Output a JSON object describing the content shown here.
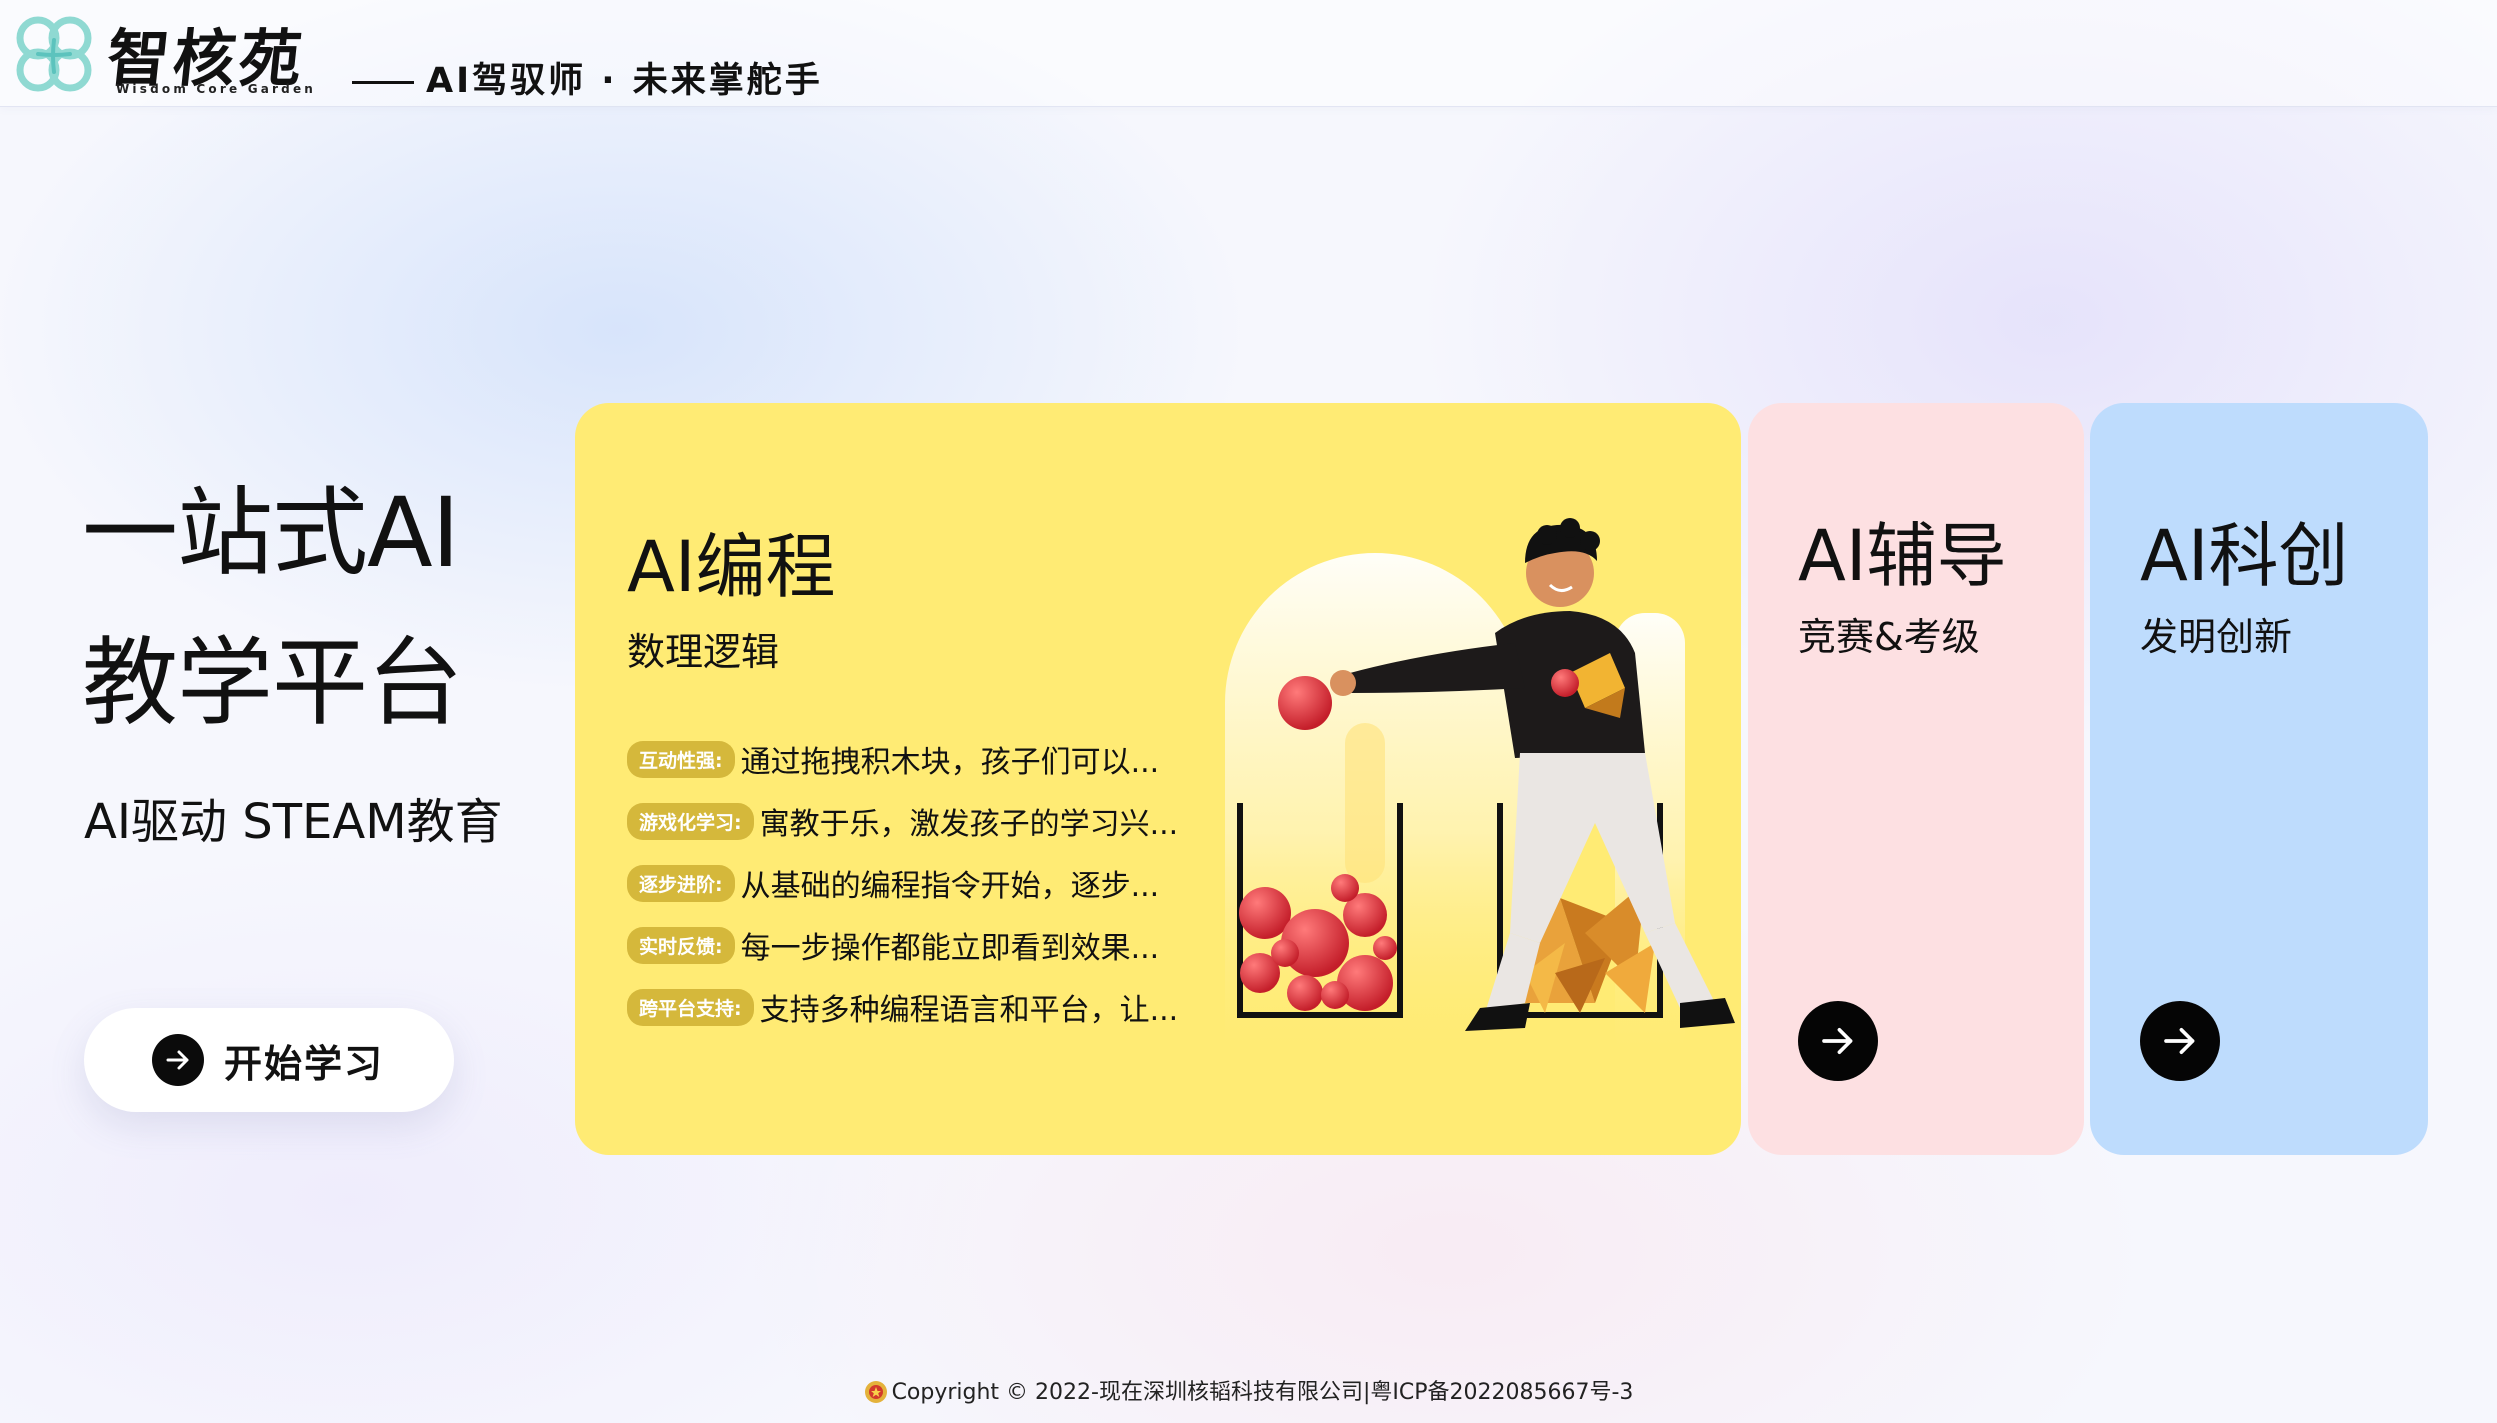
{
  "header": {
    "logo_cn": "智核苑",
    "logo_en": "Wisdom Core Garden",
    "slogan": "AI驾驭师 · 未来掌舵手"
  },
  "hero": {
    "title_line1": "一站式AI",
    "title_line2": "教学平台",
    "subtitle": "AI驱动 STEAM教育",
    "start_button": "开始学习"
  },
  "cards": {
    "programming": {
      "title": "AI编程",
      "subtitle": "数理逻辑",
      "features": [
        {
          "tag": "互动性强:",
          "text": "通过拖拽积木块，孩子们可以..."
        },
        {
          "tag": "游戏化学习:",
          "text": "寓教于乐，激发孩子的学习兴..."
        },
        {
          "tag": "逐步进阶:",
          "text": "从基础的编程指令开始，逐步..."
        },
        {
          "tag": "实时反馈:",
          "text": "每一步操作都能立即看到效果..."
        },
        {
          "tag": "跨平台支持:",
          "text": "支持多种编程语言和平台，让..."
        }
      ]
    },
    "tutoring": {
      "title": "AI辅导",
      "subtitle": "竞赛&考级"
    },
    "innovation": {
      "title": "AI科创",
      "subtitle": "发明创新"
    }
  },
  "colors": {
    "yellow_card": "#ffeb74",
    "pink_card": "#fde0e2",
    "blue_card": "#bedcfd",
    "tag": "#d5b83b"
  },
  "icons": [
    "logo-icon",
    "arrow-right-icon",
    "police-badge-icon"
  ],
  "footer": {
    "text": "Copyright © 2022-现在深圳核韬科技有限公司|粤ICP备2022085667号-3"
  }
}
